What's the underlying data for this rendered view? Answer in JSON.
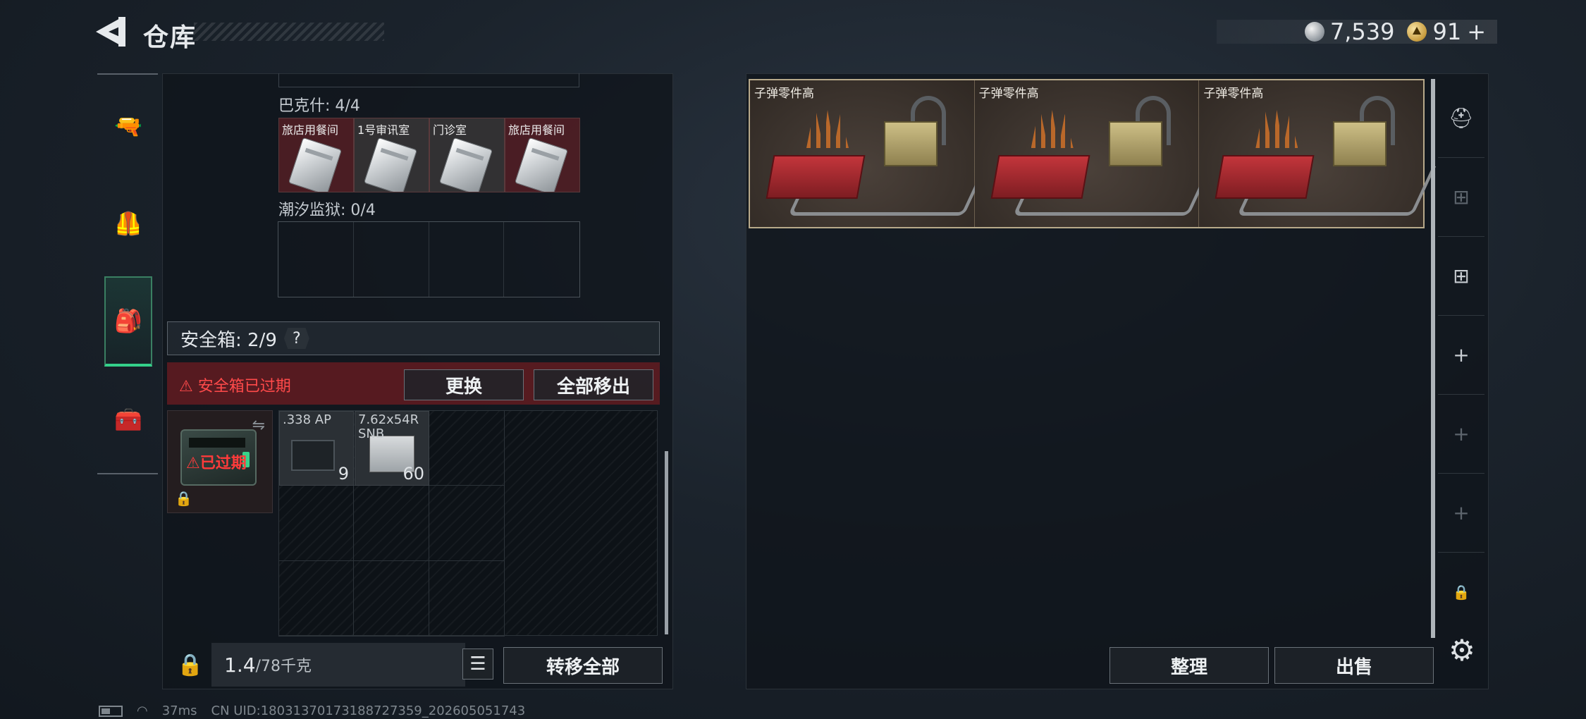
{
  "header": {
    "title": "仓库",
    "silver": "7,539",
    "gold": "91",
    "gold_plus": "+"
  },
  "left_nav": {
    "items": [
      {
        "icon": "pistol-icon",
        "glyph": "🔫"
      },
      {
        "icon": "armor-vest-icon",
        "glyph": "🦺"
      },
      {
        "icon": "backpack-icon",
        "glyph": "🎒",
        "active": true
      },
      {
        "icon": "toolbox-icon",
        "glyph": "🧰"
      }
    ]
  },
  "keys": {
    "bakeshi_label": "巴克什: 4/4",
    "bakeshi_slots": [
      {
        "label": "旅店用餐间",
        "style": "red"
      },
      {
        "label": "1号审讯室",
        "style": "light"
      },
      {
        "label": "门诊室",
        "style": "light"
      },
      {
        "label": "旅店用餐间",
        "style": "red"
      }
    ],
    "prison_label": "潮汐监狱: 0/4"
  },
  "safebox": {
    "title": "安全箱: 2/9",
    "help": "?",
    "expired_notice": "安全箱已过期",
    "replace_label": "更换",
    "remove_all_label": "全部移出",
    "expired_badge": "已过期",
    "items": [
      {
        "name": ".338 AP",
        "count": "9"
      },
      {
        "name": "7.62x54R SNB",
        "count": "60"
      }
    ]
  },
  "footer_left": {
    "weight_current": "1.4",
    "weight_max": "/78千克",
    "transfer_all_label": "转移全部"
  },
  "storage": {
    "crates": [
      {
        "name": "子弹零件高"
      },
      {
        "name": "子弹零件高"
      },
      {
        "name": "子弹零件高"
      }
    ],
    "sort_label": "整理",
    "sell_label": "出售"
  },
  "right_rail": {
    "items": [
      {
        "icon": "helmet-icon",
        "glyph": "⛑"
      },
      {
        "icon": "crate-add-icon",
        "glyph": "⊞",
        "dim": true
      },
      {
        "icon": "crate-add-icon",
        "glyph": "⊞"
      },
      {
        "icon": "plus-icon",
        "glyph": "+"
      },
      {
        "icon": "plus-icon",
        "glyph": "+",
        "dim": true
      },
      {
        "icon": "plus-icon",
        "glyph": "+",
        "dim": true
      },
      {
        "icon": "lock-icon",
        "glyph": "🔒"
      }
    ]
  },
  "status_bar": {
    "ping": "37ms",
    "uid": "CN UID:18031370173188727359_202605051743"
  }
}
